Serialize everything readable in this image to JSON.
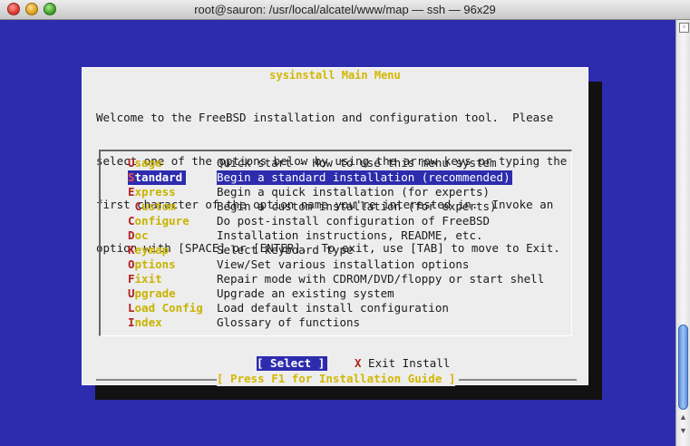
{
  "window": {
    "title": "root@sauron: /usr/local/alcatel/www/map — ssh — 96x29"
  },
  "dialog": {
    "title": "sysinstall Main Menu",
    "intro": [
      "Welcome to the FreeBSD installation and configuration tool.  Please",
      "select one of the options below by using the arrow keys or typing the",
      "first character of the option name you're interested in.  Invoke an",
      "option with [SPACE] or [ENTER].  To exit, use [TAB] to move to Exit."
    ],
    "items": [
      {
        "first": "U",
        "rest": "sage",
        "desc": "Quick start - How to use this menu system"
      },
      {
        "first": "S",
        "rest": "tandard",
        "desc": "Begin a standard installation (recommended)"
      },
      {
        "first": "E",
        "rest": "xpress",
        "desc": "Begin a quick installation (for experts)"
      },
      {
        "first": " C",
        "rest": "ustom",
        "desc": "Begin a custom installation (for experts)"
      },
      {
        "first": "C",
        "rest": "onfigure",
        "desc": "Do post-install configuration of FreeBSD"
      },
      {
        "first": "D",
        "rest": "oc",
        "desc": "Installation instructions, README, etc."
      },
      {
        "first": "K",
        "rest": "eymap",
        "desc": "Select keyboard type"
      },
      {
        "first": "O",
        "rest": "ptions",
        "desc": "View/Set various installation options"
      },
      {
        "first": "F",
        "rest": "ixit",
        "desc": "Repair mode with CDROM/DVD/floppy or start shell"
      },
      {
        "first": "U",
        "rest": "pgrade",
        "desc": "Upgrade an existing system"
      },
      {
        "first": "L",
        "rest": "oad Config",
        "desc": "Load default install configuration"
      },
      {
        "first": "I",
        "rest": "ndex",
        "desc": "Glossary of functions"
      }
    ],
    "selected_index": 1,
    "select_label": "[ Select ]",
    "exit_x": "X",
    "exit_label": " Exit Install",
    "guide": "[ Press F1 for Installation Guide ]"
  },
  "colors": {
    "terminal_bg": "#2d2cae",
    "dialog_bg": "#ededed",
    "key_color": "#c9b400",
    "hotkey_color": "#b22222"
  }
}
